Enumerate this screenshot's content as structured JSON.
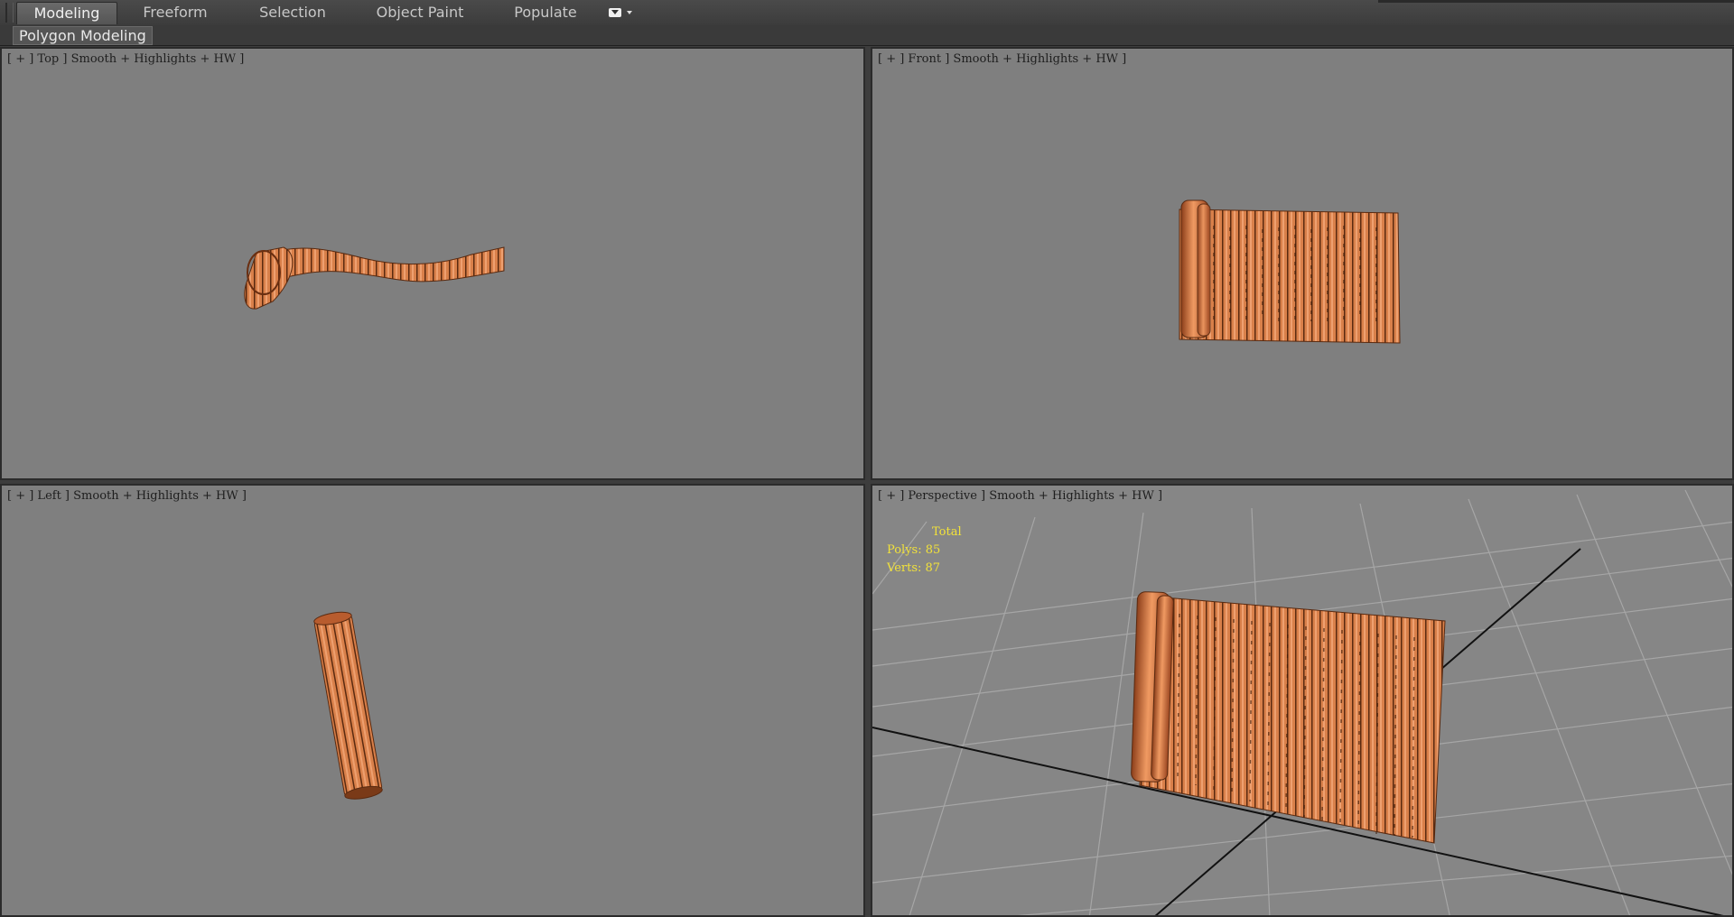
{
  "ribbon": {
    "tabs": [
      "Modeling",
      "Freeform",
      "Selection",
      "Object Paint",
      "Populate"
    ],
    "active_tab": "Modeling",
    "overflow_icon": "dropdown-toggle-icon",
    "panel_label": "Polygon Modeling"
  },
  "viewports": {
    "top": {
      "label": "[ + ] Top ] Smooth + Highlights + HW ]"
    },
    "front": {
      "label": "[ + ] Front ] Smooth + Highlights + HW ]"
    },
    "left": {
      "label": "[ + ] Left ] Smooth + Highlights + HW ]"
    },
    "perspective": {
      "label": "[ + ] Perspective ] Smooth + Highlights + HW ]"
    }
  },
  "stats": {
    "title": "Total",
    "polys": "Polys: 85",
    "verts": "Verts: 87"
  },
  "colors": {
    "viewport_bg": "#7f7f7f",
    "bamboo": "#d97a45",
    "stats_text": "#f2e23a"
  }
}
